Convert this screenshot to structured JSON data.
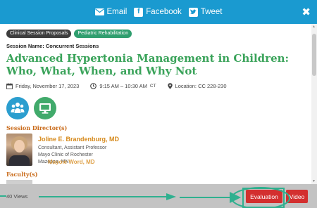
{
  "share": {
    "email_label": "Email",
    "facebook_label": "Facebook",
    "tweet_label": "Tweet",
    "close_glyph": "✖"
  },
  "tags": [
    "Clinical Session Proposals",
    "Pediatric Rehabilitation"
  ],
  "session": {
    "name_label": "Session Name: Concurrent Sessions",
    "title": "Advanced Hypertonia Management in Children: Who, What, When, and Why Not",
    "date": "Friday, November 17, 2023",
    "time": "9:15 AM – 10:30 AM",
    "timezone": "CT",
    "location": "Location: CC 228-230"
  },
  "directors": {
    "heading": "Session Director(s)",
    "people": [
      {
        "name": "Joline E. Brandenburg, MD",
        "role": "Consultant, Assistant Professor",
        "org": "Mayo Clinic of Rochester",
        "place": "Mazeppa, MN"
      }
    ]
  },
  "faculty": {
    "heading": "Faculty(s)",
    "partial_name": "Mayoie Word, MD"
  },
  "footer": {
    "views": "40 Views",
    "evaluation_label": "Evaluation",
    "video_label": "Video"
  },
  "colors": {
    "topbar": "#1a9ad0",
    "title_green": "#3aa35a",
    "person_orange": "#d68a1c",
    "button_red": "#d32f2f",
    "annotation_teal": "#2fb08f"
  }
}
